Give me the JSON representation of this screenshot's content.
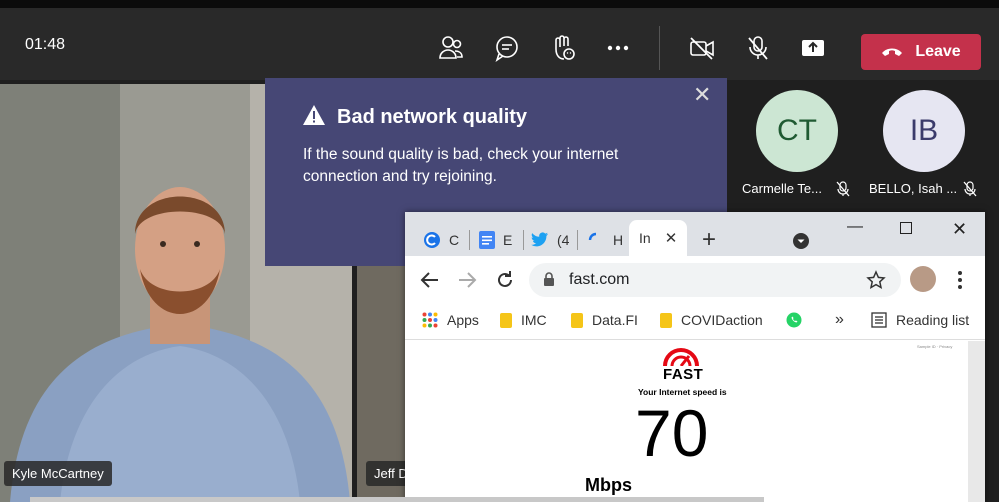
{
  "meeting": {
    "timer": "01:48",
    "leave_label": "Leave",
    "toolbar_icons": [
      "people-icon",
      "chat-icon",
      "raise-hand-icon",
      "more-icon",
      "camera-off-icon",
      "mic-off-icon",
      "share-icon"
    ]
  },
  "notification": {
    "title": "Bad network quality",
    "body": "If the sound quality is bad, check your internet connection and try rejoining."
  },
  "participants": {
    "tile1_name": "Kyle McCartney",
    "tile2_name": "Jeff D",
    "p1_initials": "CT",
    "p1_name": "Carmelle Te...",
    "p2_initials": "IB",
    "p2_name": "BELLO, Isah ..."
  },
  "browser": {
    "tabs": [
      {
        "label": "C",
        "icon": "circle-c-icon"
      },
      {
        "label": "E",
        "icon": "doc-icon"
      },
      {
        "label": "(4",
        "icon": "twitter-icon"
      },
      {
        "label": "H",
        "icon": "loading-icon"
      },
      {
        "label": "In",
        "icon": "none"
      }
    ],
    "url": "fast.com",
    "bookmarks": [
      "Apps",
      "IMC",
      "Data.FI",
      "COVIDaction"
    ],
    "reading_list": "Reading list",
    "overflow": "»"
  },
  "fast": {
    "brand": "FAST",
    "caption": "Your Internet speed is",
    "speed": "70",
    "unit": "Mbps",
    "links": "Sample ID ·  Privacy"
  },
  "colors": {
    "leave": "#c4314b",
    "notification_bg": "#464775",
    "avatar_ct_bg": "#cce6d3",
    "avatar_ct_fg": "#1f5a32",
    "avatar_ib_bg": "#e6e6f2",
    "avatar_ib_fg": "#3b3b6b",
    "fast_red": "#e50914"
  }
}
